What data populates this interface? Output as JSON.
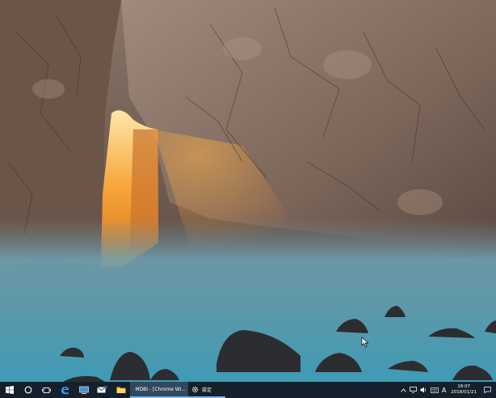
{
  "taskbar": {
    "active_window_label": "MDBI - [Chrome Wi...",
    "settings_window_label": "設定",
    "ime_indicator": "A",
    "clock": {
      "time": "18:07",
      "date": "2018/01/21"
    }
  },
  "colors": {
    "taskbar_bg": "#16202c",
    "active_task_bg": "#31485f",
    "accent": "#76b9ed"
  }
}
